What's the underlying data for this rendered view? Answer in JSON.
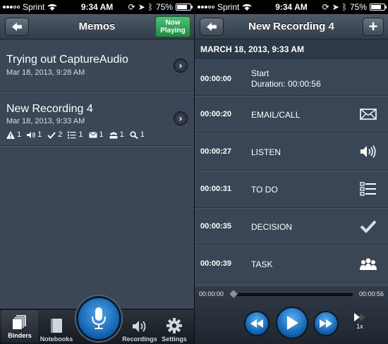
{
  "left": {
    "status": {
      "carrier": "Sprint",
      "time": "9:34 AM",
      "battery": "75%",
      "battery_level": 0.75
    },
    "nav": {
      "title": "Memos",
      "now_playing": "Now Playing"
    },
    "memos": [
      {
        "title": "Trying out CaptureAudio",
        "date": "Mar 18, 2013, 9:28 AM"
      },
      {
        "title": "New Recording 4",
        "date": "Mar 18, 2013, 9:33 AM",
        "counts": [
          {
            "icon": "warning-icon",
            "value": "1"
          },
          {
            "icon": "speaker-icon",
            "value": "1"
          },
          {
            "icon": "checkmark-icon",
            "value": "2"
          },
          {
            "icon": "todo-list-icon",
            "value": "1"
          },
          {
            "icon": "envelope-icon",
            "value": "1"
          },
          {
            "icon": "people-icon",
            "value": "1"
          },
          {
            "icon": "magnifier-icon",
            "value": "1"
          }
        ]
      }
    ],
    "tabs": {
      "binders": "Binders",
      "notebooks": "Notebooks",
      "recordings": "Recordings",
      "settings": "Settings"
    }
  },
  "right": {
    "status": {
      "carrier": "Sprint",
      "time": "9:34 AM",
      "battery": "75%",
      "battery_level": 0.75
    },
    "nav": {
      "title": "New Recording 4",
      "add": "+"
    },
    "date_header": "MARCH 18, 2013, 9:33 AM",
    "events": [
      {
        "time": "00:00:00",
        "label": "Start",
        "sub": "Duration: 00:00:56",
        "icon": ""
      },
      {
        "time": "00:00:20",
        "label": "EMAIL/CALL",
        "icon": "envelope-icon"
      },
      {
        "time": "00:00:27",
        "label": "LISTEN",
        "icon": "speaker-icon"
      },
      {
        "time": "00:00:31",
        "label": "TO DO",
        "icon": "todo-list-icon"
      },
      {
        "time": "00:00:35",
        "label": "DECISION",
        "icon": "checkmark-icon"
      },
      {
        "time": "00:00:39",
        "label": "TASK",
        "icon": "people-icon"
      }
    ],
    "player": {
      "elapsed": "00:00:00",
      "total": "00:00:56",
      "speed": "1x",
      "progress": 0
    }
  },
  "colors": {
    "accent_blue": "#1a73c2",
    "now_playing_green": "#2fa055",
    "background": "#3b4757"
  }
}
